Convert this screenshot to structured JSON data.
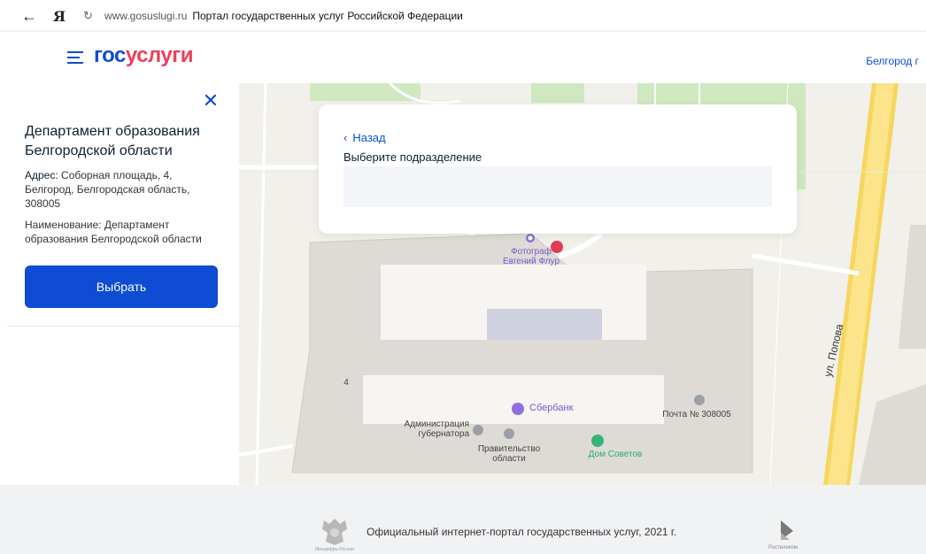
{
  "browser": {
    "back_icon": "arrow-left-icon",
    "brand_glyph": "Я",
    "url": "www.gosuslugi.ru",
    "page_title": "Портал государственных услуг Российской Федерации"
  },
  "header": {
    "logo_part1": "гос",
    "logo_part2": "услуги",
    "city": "Белгород г"
  },
  "panel": {
    "title": "Департамент образования Белгородской области",
    "address_label": "Адрес:",
    "address_value": "Соборная площадь, 4, Белгород, Белгородская область, 308005",
    "name_label": "Наименование:",
    "name_value": "Департамент образования Белгородской области",
    "select_button": "Выбрать"
  },
  "modal": {
    "back_label": "Назад",
    "select_label": "Выберите подразделение",
    "input_value": ""
  },
  "map": {
    "labels": {
      "photo": "Фотограф Евгений Флур",
      "sberbank": "Сбербанк",
      "post": "Почта № 308005",
      "admin": "Администрация губернатора",
      "gov": "Правительство области",
      "house": "Дом Советов",
      "building_num": "4",
      "street": "ул. Попова"
    }
  },
  "footer": {
    "text": "Официальный интернет-портал государственных услуг, 2021 г.",
    "emblem_caption": "Минцифры России",
    "partner": "Ростелеком"
  },
  "colors": {
    "accent": "#0d4cd3",
    "logo_red": "#ee3f58",
    "footer_bg": "#f1f2f4"
  }
}
